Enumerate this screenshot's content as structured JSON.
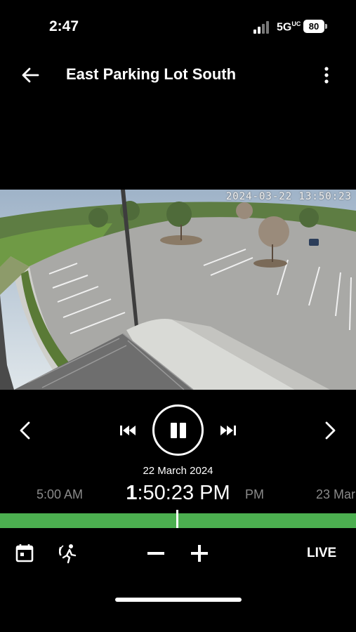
{
  "status_bar": {
    "time": "2:47",
    "network": "5G",
    "network_sup": "UC",
    "battery": "80"
  },
  "header": {
    "title": "East Parking Lot South"
  },
  "video": {
    "overlay_timestamp": "2024-03-22 13:50:23"
  },
  "playback": {
    "date": "22 March 2024",
    "current_time": {
      "hour": "1",
      "sep1": ":",
      "minute": "50",
      "sep2": ":",
      "rest": "23 PM"
    },
    "timeline_labels": [
      "5:00 AM",
      "PM",
      "23 Mar"
    ]
  },
  "toolbar": {
    "live_label": "LIVE"
  },
  "colors": {
    "timeline": "#4caf50",
    "background": "#000000"
  },
  "icons": [
    "back-arrow-icon",
    "more-vert-icon",
    "chevron-left-icon",
    "skip-previous-icon",
    "pause-icon",
    "skip-next-icon",
    "chevron-right-icon",
    "calendar-icon",
    "motion-person-icon",
    "zoom-out-icon",
    "zoom-in-icon"
  ]
}
